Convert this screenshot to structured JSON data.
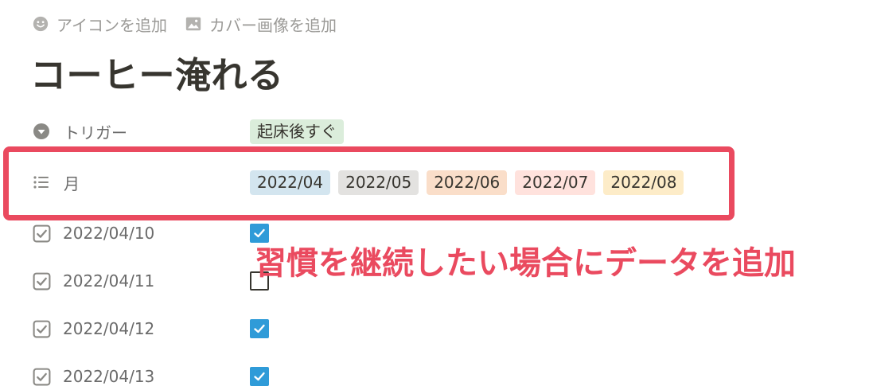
{
  "page_actions": {
    "add_icon": "アイコンを追加",
    "add_cover": "カバー画像を追加"
  },
  "page_title": "コーヒー淹れる",
  "properties": {
    "trigger": {
      "name": "トリガー",
      "value": "起床後すぐ",
      "value_color": "#dbeddb"
    },
    "month": {
      "name": "月",
      "tags": [
        {
          "label": "2022/04",
          "color": "#d3e5ef"
        },
        {
          "label": "2022/05",
          "color": "#e3e2e0"
        },
        {
          "label": "2022/06",
          "color": "#fadec9"
        },
        {
          "label": "2022/07",
          "color": "#ffe2dd"
        },
        {
          "label": "2022/08",
          "color": "#fdecc8"
        }
      ]
    },
    "dates": [
      {
        "name": "2022/04/10",
        "checked": true
      },
      {
        "name": "2022/04/11",
        "checked": false
      },
      {
        "name": "2022/04/12",
        "checked": true
      },
      {
        "name": "2022/04/13",
        "checked": true
      }
    ]
  },
  "annotation": {
    "text": "習慣を継続したい場合にデータを追加",
    "color": "#ea4a5f"
  }
}
